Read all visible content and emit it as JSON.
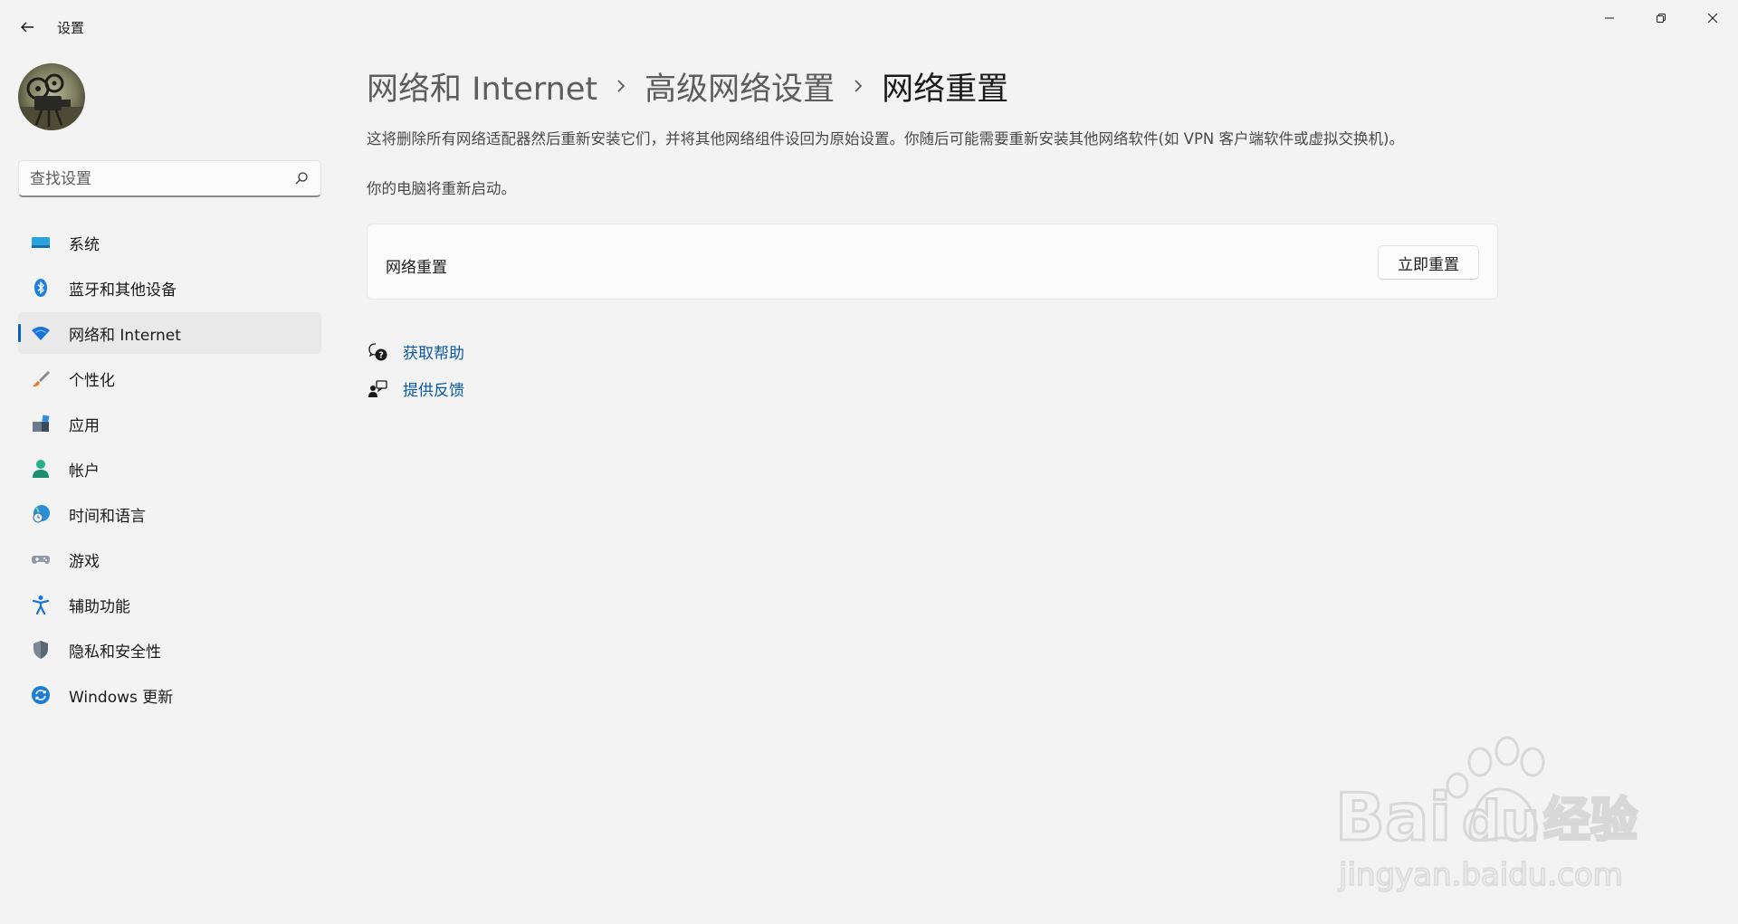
{
  "window": {
    "title": "设置"
  },
  "sidebar": {
    "search_placeholder": "查找设置",
    "items": [
      {
        "label": "系统",
        "icon": "system-icon",
        "selected": false
      },
      {
        "label": "蓝牙和其他设备",
        "icon": "bluetooth-icon",
        "selected": false
      },
      {
        "label": "网络和 Internet",
        "icon": "wifi-icon",
        "selected": true
      },
      {
        "label": "个性化",
        "icon": "brush-icon",
        "selected": false
      },
      {
        "label": "应用",
        "icon": "apps-icon",
        "selected": false
      },
      {
        "label": "帐户",
        "icon": "person-icon",
        "selected": false
      },
      {
        "label": "时间和语言",
        "icon": "globe-clock-icon",
        "selected": false
      },
      {
        "label": "游戏",
        "icon": "gamepad-icon",
        "selected": false
      },
      {
        "label": "辅助功能",
        "icon": "accessibility-icon",
        "selected": false
      },
      {
        "label": "隐私和安全性",
        "icon": "shield-icon",
        "selected": false
      },
      {
        "label": "Windows 更新",
        "icon": "update-icon",
        "selected": false
      }
    ]
  },
  "main": {
    "breadcrumb": [
      "网络和 Internet",
      "高级网络设置",
      "网络重置"
    ],
    "description": "这将删除所有网络适配器然后重新安装它们，并将其他网络组件设回为原始设置。你随后可能需要重新安装其他网络软件(如 VPN 客户端软件或虚拟交换机)。",
    "restart_note": "你的电脑将重新启动。",
    "card": {
      "label": "网络重置",
      "button_label": "立即重置"
    },
    "links": [
      {
        "label": "获取帮助",
        "icon": "help-chat-icon"
      },
      {
        "label": "提供反馈",
        "icon": "feedback-icon"
      }
    ]
  },
  "watermark": {
    "brand": "Bai du 经验",
    "url": "jingyan.baidu.com"
  },
  "colors": {
    "accent": "#005fb8",
    "link": "#0a5aa8",
    "background": "#f3f3f3"
  }
}
